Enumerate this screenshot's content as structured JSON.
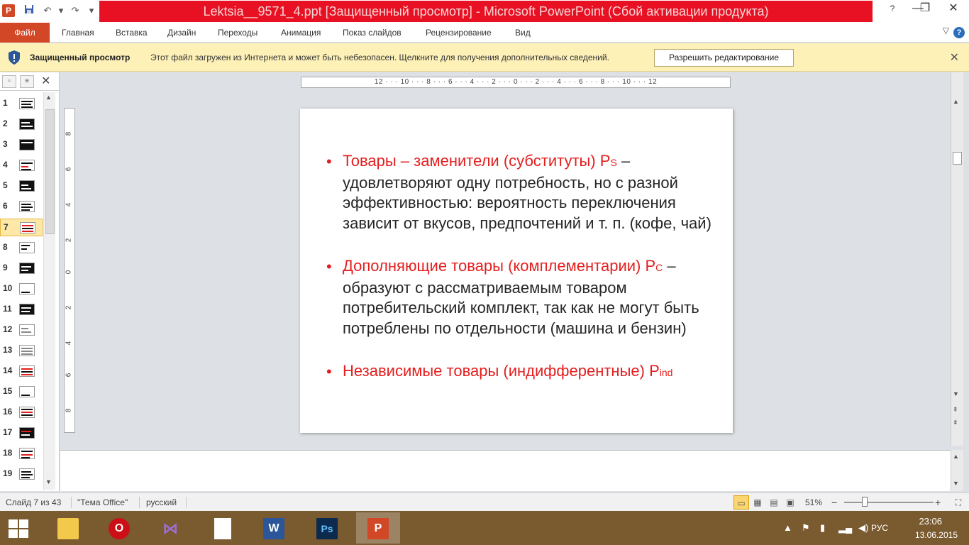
{
  "window": {
    "title": "Lektsia__9571_4.ppt [Защищенный просмотр] - Microsoft PowerPoint (Сбой активации продукта)",
    "app_logo": "P",
    "minimize": "—",
    "restore": "❐",
    "close": "✕",
    "title_bar_color": "#e81123"
  },
  "quick_access": {
    "save_icon": "save-icon",
    "undo": "↶",
    "redo": "↷",
    "customize": "▾"
  },
  "ribbon": {
    "file_tab": "Файл",
    "tabs": [
      "Главная",
      "Вставка",
      "Дизайн",
      "Переходы",
      "Анимация",
      "Показ слайдов",
      "Рецензирование",
      "Вид"
    ],
    "collapse_icon": "▽",
    "help": "?"
  },
  "protected_view": {
    "title": "Защищенный просмотр",
    "message": "Этот файл загружен из Интернета и может быть небезопасен. Щелкните для получения дополнительных сведений.",
    "enable_button": "Разрешить редактирование",
    "close": "✕"
  },
  "thumbnails": {
    "close": "✕",
    "active": 7,
    "numbers": [
      "1",
      "2",
      "3",
      "4",
      "5",
      "6",
      "7",
      "8",
      "9",
      "10",
      "11",
      "12",
      "13",
      "14",
      "15",
      "16",
      "17",
      "18",
      "19"
    ]
  },
  "ruler": {
    "horizontal": "12 · · · 10 · · · 8 · · · 6 · · · 4 · · · 2 · · · 0 · · · 2 · · · 4 · · · 6 · · · 8 · · · 10 · · · 12",
    "vertical_ticks": [
      "8",
      "6",
      "4",
      "2",
      "0",
      "2",
      "4",
      "6",
      "8"
    ]
  },
  "slide": {
    "bullet": "•",
    "items": [
      {
        "heading": "Товары – заменители (субституты)  P",
        "sub": "S",
        "rest": "  – удовлетворяют одну потребность, но с разной эффективностью: вероятность переключения зависит от вкусов, предпочтений и т. п. (кофе, чай)"
      },
      {
        "heading": "Дополняющие товары (комплементарии) P",
        "sub": "C",
        "rest": " – образуют с рассматриваемым товаром потребительский комплект, так как не могут быть потреблены по отдельности (машина и бензин)"
      },
      {
        "heading": "Независимые товары (индифферентные) P",
        "sub": "ind",
        "rest": ""
      }
    ],
    "accent_color": "#e41e1e"
  },
  "status": {
    "slide_info": "Слайд 7 из 43",
    "theme": "\"Тема Office\"",
    "language": "русский",
    "zoom": "51%",
    "zoom_minus": "−",
    "zoom_plus": "+"
  },
  "taskbar": {
    "apps": [
      "file-explorer",
      "opera",
      "visual-studio",
      "document",
      "word",
      "photoshop",
      "powerpoint"
    ],
    "active_app": "powerpoint",
    "language": "РУС",
    "time": "23:06",
    "date": "13.06.2015"
  }
}
